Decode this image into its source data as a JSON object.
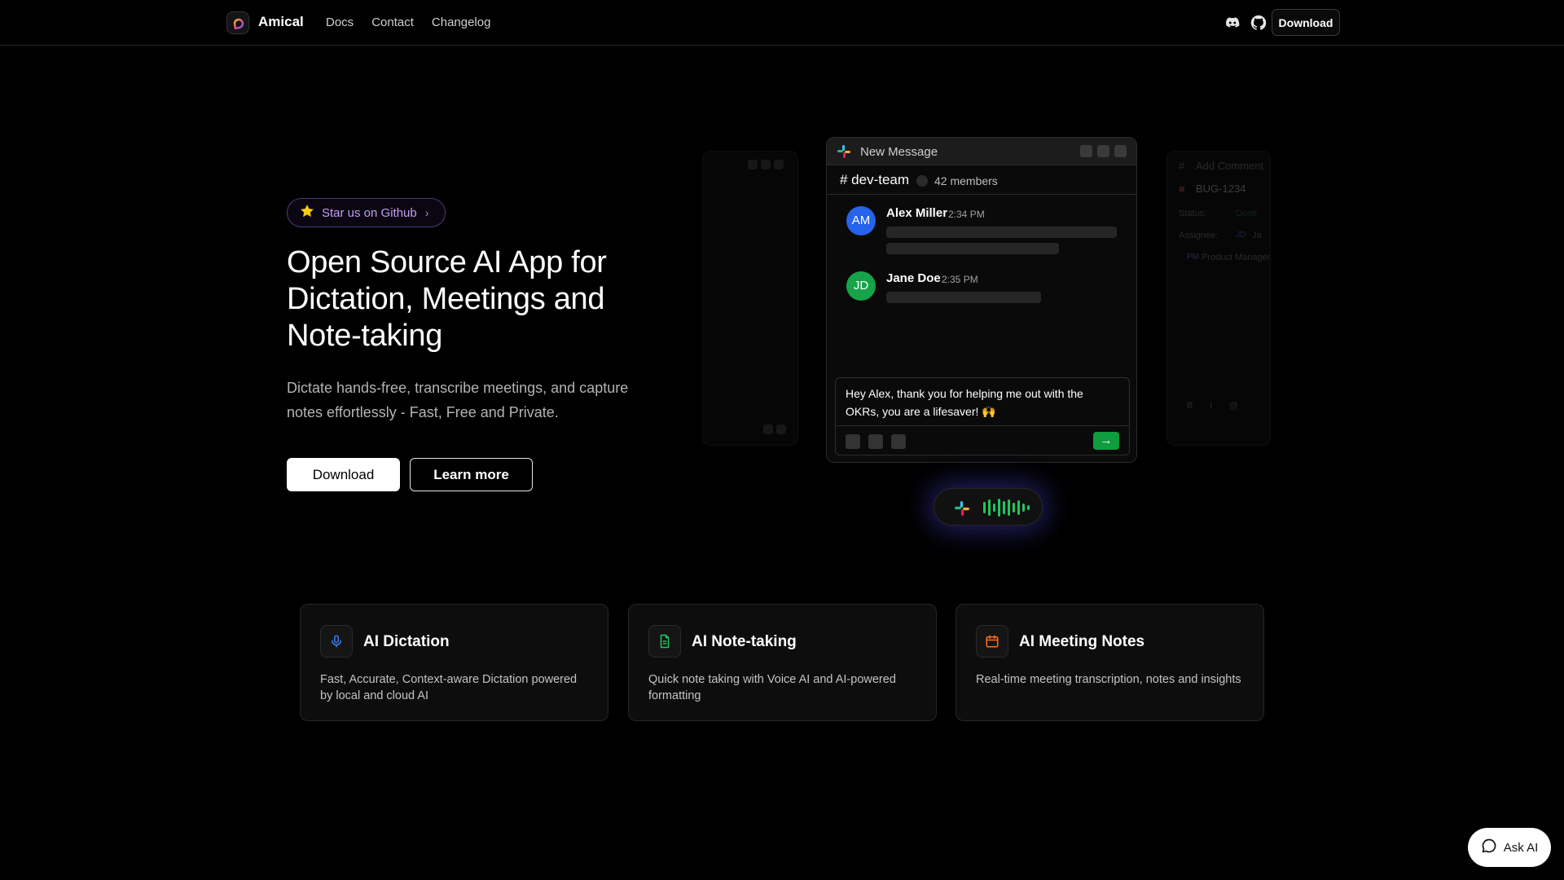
{
  "nav": {
    "brand": "Amical",
    "links": [
      "Docs",
      "Contact",
      "Changelog"
    ],
    "icons": [
      "discord-icon",
      "github-icon"
    ],
    "download_label": "Download"
  },
  "hero": {
    "badge_label": "Star us on Github",
    "title": "Open Source AI App for Dictation, Meetings and Note-taking",
    "subtitle": "Dictate hands-free, transcribe meetings, and capture notes effortlessly - Fast, Free and Private.",
    "primary_button": "Download",
    "secondary_button": "Learn more"
  },
  "mockup": {
    "window_title": "New Message",
    "channel": "# dev-team",
    "members": "42 members",
    "messages": [
      {
        "initials": "AM",
        "name": "Alex Miller",
        "time": "2:34 PM",
        "avatar_color": "#2563eb"
      },
      {
        "initials": "JD",
        "name": "Jane Doe",
        "time": "2:35 PM",
        "avatar_color": "#16a34a"
      }
    ],
    "composer_text": "Hey Alex, thank you for helping me out with the OKRs, you are a lifesaver! 🙌",
    "send_label": "→",
    "right_window": {
      "title": "Add Comment",
      "issue": "BUG-1234",
      "status_label": "Status:",
      "status_value": "Done",
      "assignee_label": "Assignee:",
      "assignee_initials": "JD",
      "assignee_name_fragment": "Ja",
      "comment_initials": "PM",
      "comment_author": "Product Manager",
      "format_buttons": [
        "B",
        "I",
        "@"
      ]
    }
  },
  "features": [
    {
      "icon": "microphone-icon",
      "title": "AI Dictation",
      "description": "Fast, Accurate, Context-aware Dictation powered by local and cloud AI",
      "accent": "#3b82f6"
    },
    {
      "icon": "document-icon",
      "title": "AI Note-taking",
      "description": "Quick note taking with Voice AI and AI-powered formatting",
      "accent": "#22c55e"
    },
    {
      "icon": "calendar-icon",
      "title": "AI Meeting Notes",
      "description": "Real-time meeting transcription, notes and insights",
      "accent": "#f97316"
    }
  ],
  "ask_ai_label": "Ask AI",
  "colors": {
    "background": "#000000",
    "badge_text": "#c69bf5",
    "send_green": "#0f9d3f",
    "wave_green": "#22c55e",
    "glow": "#5046dc"
  }
}
